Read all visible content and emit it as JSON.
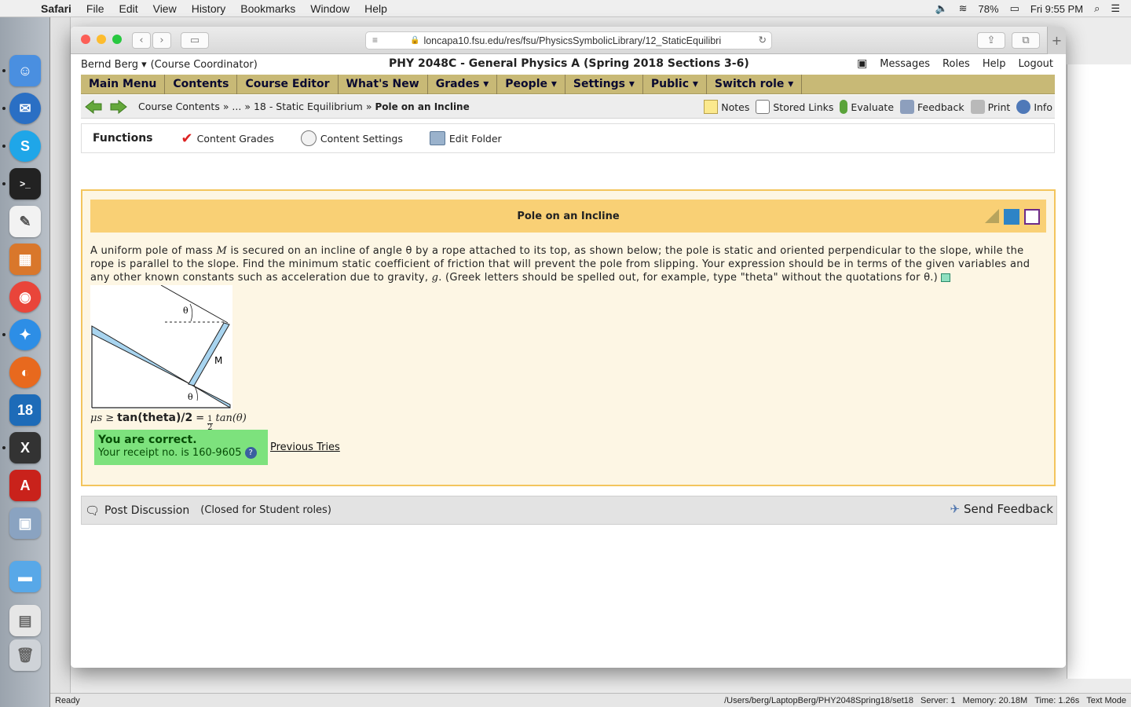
{
  "menubar": {
    "app": "Safari",
    "items": [
      "File",
      "Edit",
      "View",
      "History",
      "Bookmarks",
      "Window",
      "Help"
    ],
    "battery": "78%",
    "clock": "Fri 9:55 PM"
  },
  "browser": {
    "url": "loncapa10.fsu.edu/res/fsu/PhysicsSymbolicLibrary/12_StaticEquilibri"
  },
  "user": {
    "name": "Bernd Berg ▾",
    "role": "(Course Coordinator)",
    "course": "PHY 2048C - General Physics A (Spring 2018 Sections 3-6)",
    "links": [
      "Messages",
      "Roles",
      "Help",
      "Logout"
    ]
  },
  "mainnav": [
    "Main Menu",
    "Contents",
    "Course Editor",
    "What's New",
    "Grades ▾",
    "People ▾",
    "Settings ▾",
    "Public ▾",
    "Switch role ▾"
  ],
  "crumbs": {
    "path": "Course Contents » ... » 18 - Static Equilibrium » ",
    "current": "Pole on an Incline",
    "tools": [
      "Notes",
      "Stored Links",
      "Evaluate",
      "Feedback",
      "Print",
      "Info"
    ]
  },
  "functions": {
    "title": "Functions",
    "items": [
      "Content Grades",
      "Content Settings",
      "Edit Folder"
    ]
  },
  "problem": {
    "title": "Pole on an Incline",
    "text_1": "A uniform pole of mass ",
    "var_m": "M",
    "text_2": " is secured on an incline of angle θ by a rope attached to its top, as shown below; the pole is static and oriented perpendicular to the slope, while the rope is parallel to the slope. Find the minimum static coefficient of friction that will prevent the pole from slipping. Your expression should be in terms of the given variables and any other known constants such as acceleration due to gravity, ",
    "var_g": "g",
    "text_3": ". (Greek letters should be spelled out, for example, type \"theta\" without the quotations for θ.)",
    "figure": {
      "theta_top": "θ",
      "theta_bottom": "θ",
      "mass": "M"
    },
    "answer_lhs": "μs ≥",
    "answer": "tan(theta)/2",
    "answer_eq": "=",
    "answer_num": "1",
    "answer_den": "2",
    "answer_rendered": "tan(θ)",
    "correct": "You are correct.",
    "receipt": "Your receipt no. is 160-9605",
    "previous_tries": "Previous Tries"
  },
  "discussion": {
    "post": "Post Discussion",
    "closed": "(Closed for Student roles)",
    "send_feedback": "Send Feedback"
  },
  "statusbar": {
    "left": "Ready",
    "path": "/Users/berg/LaptopBerg/PHY2048Spring18/set18",
    "server": "Server: 1",
    "memory": "Memory: 20.18M",
    "time": "Time: 1.26s",
    "mode": "Text Mode"
  },
  "colors": {
    "nav_bg": "#c8b976",
    "problem_header": "#f9d075",
    "correct_bg": "#7de27d"
  }
}
